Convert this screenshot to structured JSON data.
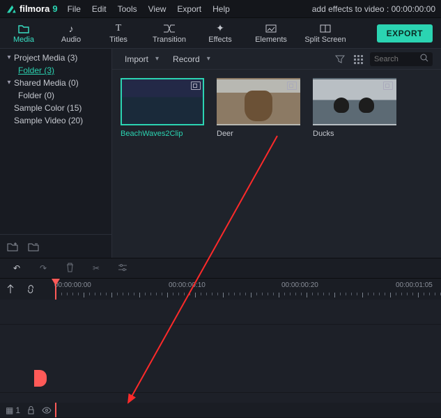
{
  "app": {
    "name": "filmora",
    "version": "9"
  },
  "menu": [
    "File",
    "Edit",
    "Tools",
    "View",
    "Export",
    "Help"
  ],
  "title_right": "add effects to video : 00:00:00:00",
  "tooltabs": {
    "media": "Media",
    "audio": "Audio",
    "titles": "Titles",
    "transition": "Transition",
    "effects": "Effects",
    "elements": "Elements",
    "split": "Split Screen"
  },
  "export_btn": "EXPORT",
  "tree": {
    "project_media": "Project Media (3)",
    "project_folder": "Folder (3)",
    "shared_media": "Shared Media (0)",
    "shared_folder": "Folder (0)",
    "sample_color": "Sample Color (15)",
    "sample_video": "Sample Video (20)"
  },
  "content_bar": {
    "import": "Import",
    "record": "Record",
    "search_placeholder": "Search"
  },
  "clips": [
    {
      "label": "BeachWaves2Clip",
      "kind": "waves",
      "active": true
    },
    {
      "label": "Deer",
      "kind": "deer",
      "active": false
    },
    {
      "label": "Ducks",
      "kind": "ducks",
      "active": false
    }
  ],
  "timeline": {
    "majors": [
      "00:00:00:00",
      "00:00:00:10",
      "00:00:00:20",
      "00:00:01:05"
    ],
    "track_label": "1"
  }
}
